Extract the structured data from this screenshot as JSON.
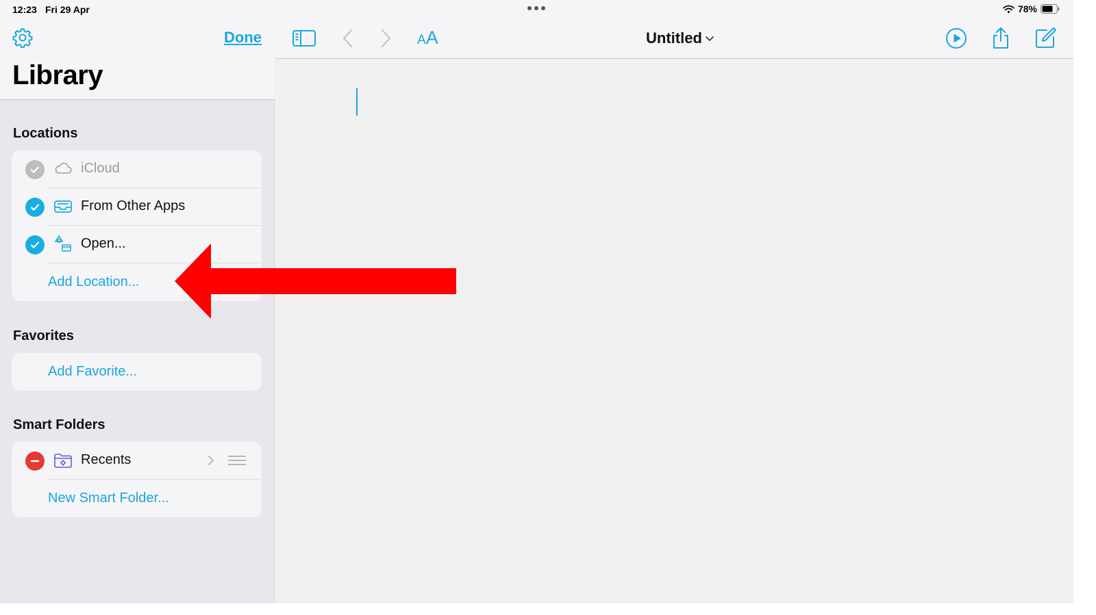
{
  "status_bar": {
    "time": "12:23",
    "date": "Fri 29 Apr",
    "battery": "78%"
  },
  "sidebar": {
    "done_label": "Done",
    "title": "Library",
    "locations": {
      "title": "Locations",
      "items": [
        {
          "label": "iCloud",
          "checked": true,
          "disabled": true,
          "icon": "cloud-icon"
        },
        {
          "label": "From Other Apps",
          "checked": true,
          "icon": "inbox-tray-icon"
        },
        {
          "label": "Open...",
          "checked": true,
          "icon": "shapes-icon"
        }
      ],
      "add_label": "Add Location..."
    },
    "favorites": {
      "title": "Favorites",
      "add_label": "Add Favorite..."
    },
    "smart_folders": {
      "title": "Smart Folders",
      "items": [
        {
          "label": "Recents",
          "icon": "smart-folder-icon"
        }
      ],
      "add_label": "New Smart Folder..."
    }
  },
  "toolbar": {
    "document_title": "Untitled"
  },
  "colors": {
    "accent": "#1ba6dd",
    "check": "#19aee3",
    "remove": "#e53935",
    "annotation_arrow": "#ff0000"
  }
}
